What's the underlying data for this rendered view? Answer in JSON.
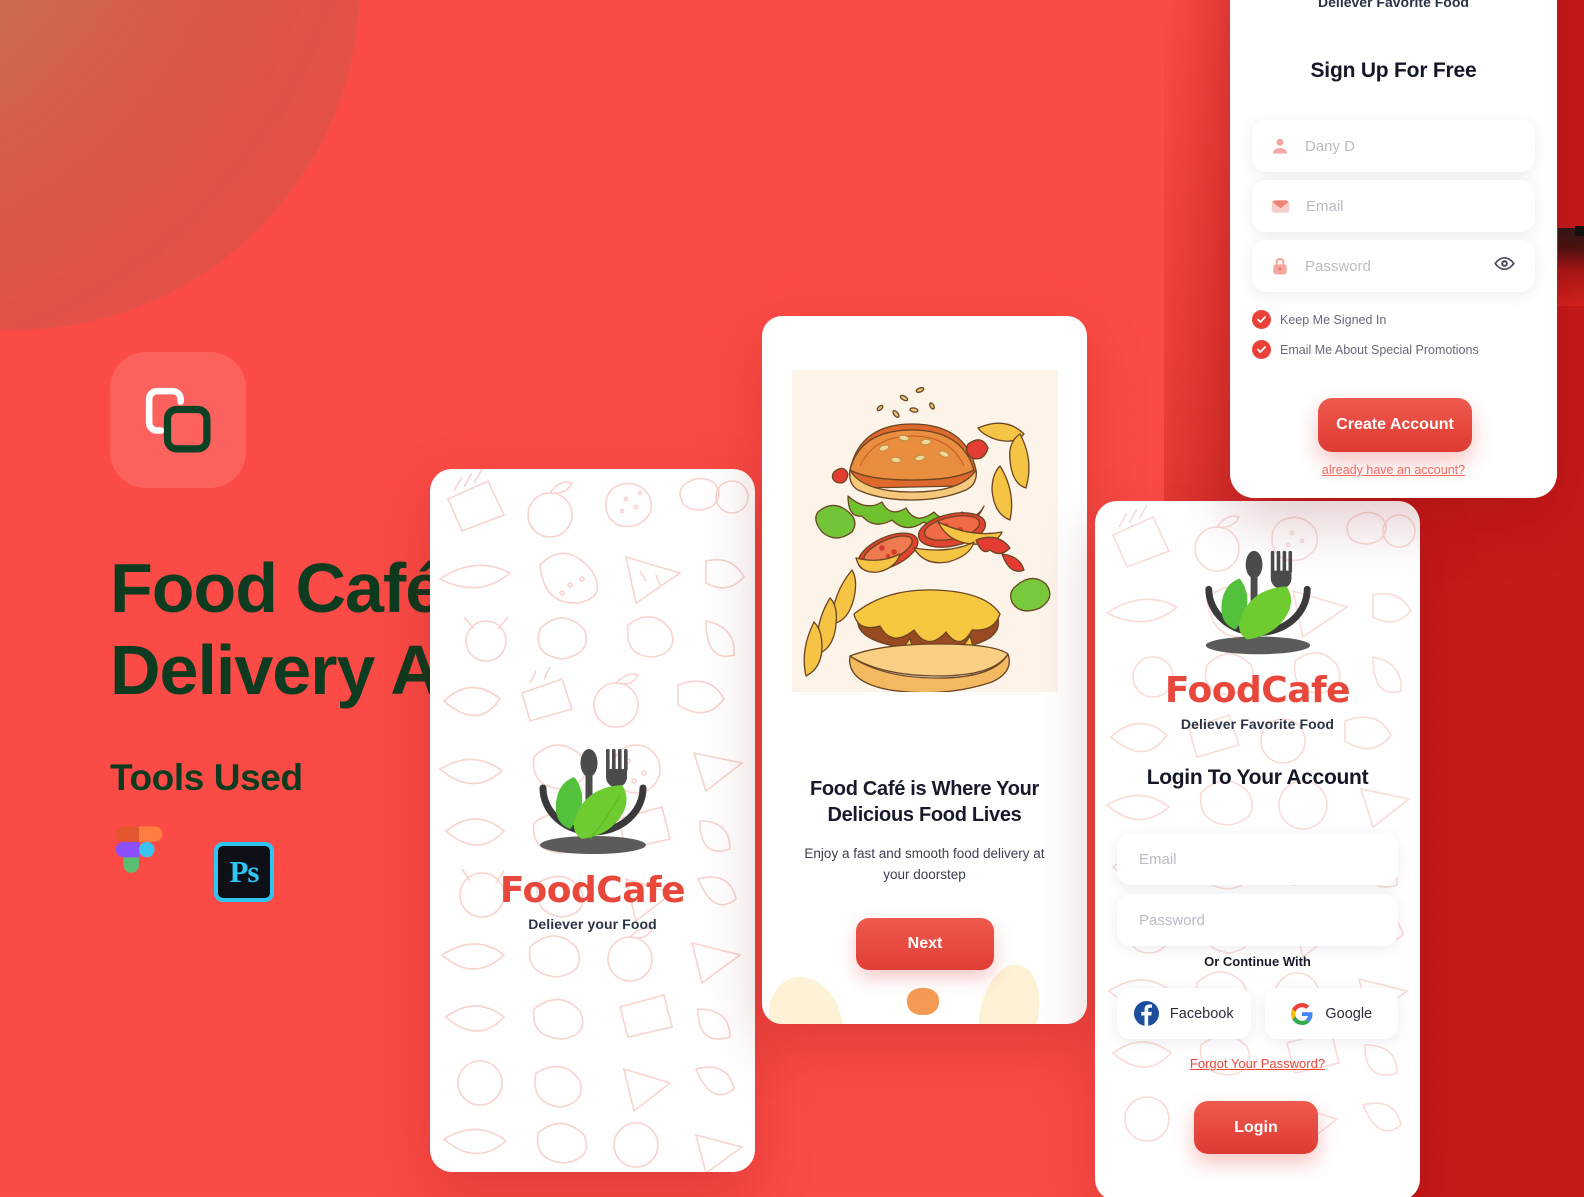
{
  "background": {
    "accent_red": "#fc4b46",
    "dark_red": "#c6191a",
    "circle_gradient_from": "#b88b66",
    "circle_gradient_to": "#ee4f49"
  },
  "intro": {
    "app_icon_name": "overlapping-squares-icon",
    "headline": "Food Café Food\nDelivery App",
    "headline_color": "#0d3b1f",
    "tools_label": "Tools Used",
    "tools": [
      {
        "name": "figma-icon",
        "label": "Figma"
      },
      {
        "name": "photoshop-icon",
        "label": "Ps"
      }
    ]
  },
  "splash_screen": {
    "logo": {
      "word_left": "Food",
      "word_right": "Cafe",
      "tagline": "Deliever your Food",
      "word_color": "#e8483c"
    }
  },
  "onboarding_screen": {
    "illustration_name": "exploded-burger-illustration",
    "title": "Food Café is Where Your Delicious Food Lives",
    "subtitle": "Enjoy a fast and smooth food delivery at your doorstep",
    "next_button": "Next"
  },
  "login_screen": {
    "logo": {
      "word_left": "Food",
      "word_right": "Cafe",
      "tagline": "Deliever Favorite Food"
    },
    "title": "Login To Your Account",
    "fields": [
      {
        "name": "email-field",
        "placeholder": "Email",
        "value": ""
      },
      {
        "name": "password-field",
        "placeholder": "Password",
        "value": ""
      }
    ],
    "or_continue": "Or Continue With",
    "social": [
      {
        "name": "facebook-button",
        "label": "Facebook",
        "color": "#1877f2"
      },
      {
        "name": "google-button",
        "label": "Google",
        "color": "#4285f4"
      }
    ],
    "forgot_link": "Forgot Your Password?",
    "login_button": "Login"
  },
  "signup_screen": {
    "tagline": "Deliever Favorite Food",
    "title": "Sign Up For Free",
    "fields": [
      {
        "name": "name-field",
        "icon": "user-icon",
        "placeholder": "Dany D",
        "value": ""
      },
      {
        "name": "email-field",
        "icon": "envelope-icon",
        "placeholder": "Email",
        "value": ""
      },
      {
        "name": "password-field",
        "icon": "lock-icon",
        "placeholder": "Password",
        "value": ""
      }
    ],
    "checkboxes": [
      {
        "name": "keep-signed-in-checkbox",
        "label": "Keep Me Signed In",
        "checked": true
      },
      {
        "name": "promotions-checkbox",
        "label": "Email Me About Special Promotions",
        "checked": true
      }
    ],
    "create_button": "Create Account",
    "already_link": "already have an account?"
  }
}
